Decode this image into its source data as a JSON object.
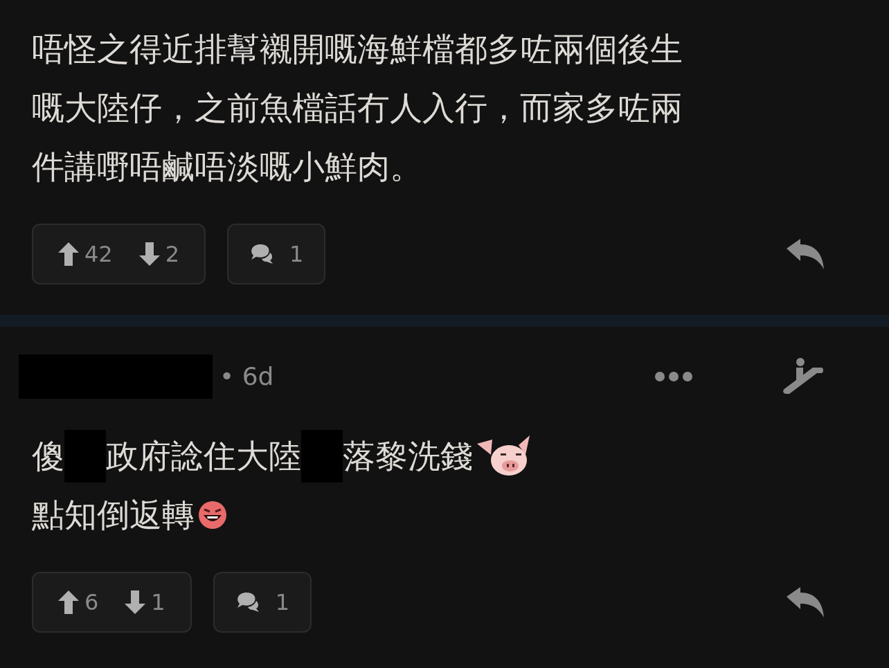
{
  "posts": [
    {
      "lines": [
        [
          {
            "kind": "text",
            "text": "唔怪之得近排幫襯開嘅海鮮檔都多咗兩個後生"
          }
        ],
        [
          {
            "kind": "text",
            "text": "嘅大陸仔，之前魚檔話冇人入行，而家多咗兩"
          }
        ],
        [
          {
            "kind": "text",
            "text": "件講嘢唔鹹唔淡嘅小鮮肉。"
          }
        ]
      ],
      "upvotes": "42",
      "downvotes": "2",
      "replies": "1"
    },
    {
      "header": {
        "author_redacted": true,
        "age": "• 6d"
      },
      "lines": [
        [
          {
            "kind": "text",
            "text": "傻"
          },
          {
            "kind": "redacted"
          },
          {
            "kind": "text",
            "text": "政府諗住大陸"
          },
          {
            "kind": "redacted"
          },
          {
            "kind": "text",
            "text": "落黎洗錢"
          },
          {
            "kind": "pig-sticker"
          }
        ],
        [
          {
            "kind": "text",
            "text": "點知倒返轉"
          },
          {
            "kind": "laugh-sticker"
          }
        ]
      ],
      "upvotes": "6",
      "downvotes": "1",
      "replies": "1"
    }
  ]
}
